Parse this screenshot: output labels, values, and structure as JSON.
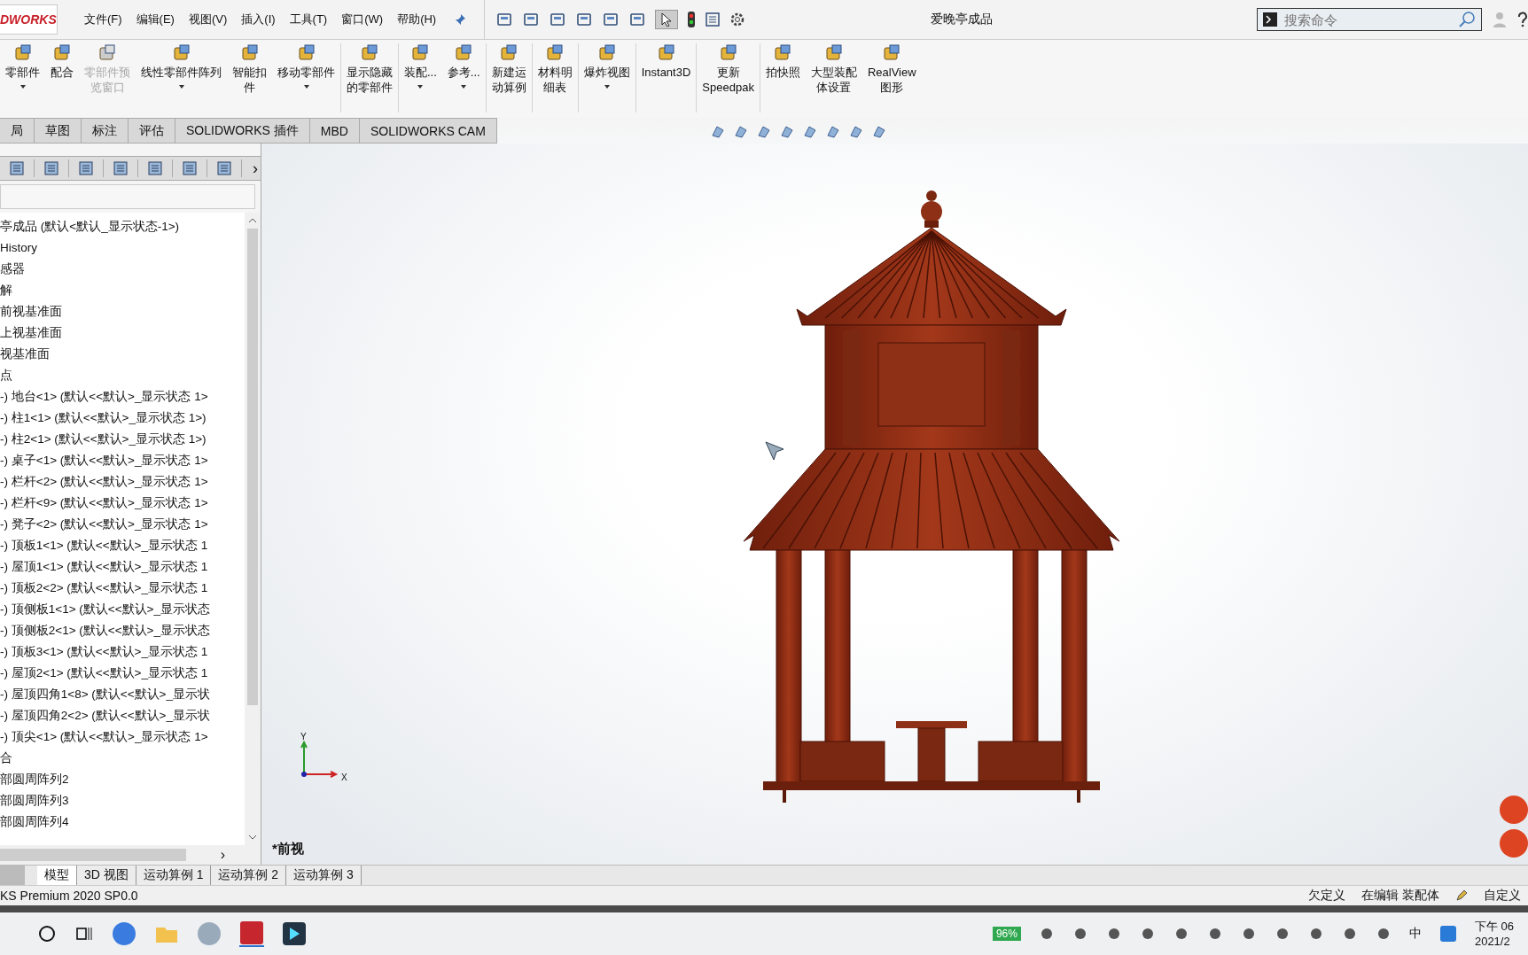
{
  "window": {
    "title": "爱晚亭成品",
    "logo": "DWORKS"
  },
  "menu": [
    "文件(F)",
    "编辑(E)",
    "视图(V)",
    "插入(I)",
    "工具(T)",
    "窗口(W)",
    "帮助(H)"
  ],
  "search": {
    "placeholder": "搜索命令"
  },
  "ribbon": [
    {
      "lines": [
        "零部件"
      ],
      "disabled": false,
      "dropdown": true,
      "divider": false
    },
    {
      "lines": [
        "配合"
      ],
      "disabled": false,
      "dropdown": false,
      "divider": false
    },
    {
      "lines": [
        "零部件预",
        "览窗口"
      ],
      "disabled": true,
      "dropdown": false,
      "divider": false
    },
    {
      "lines": [
        "线性零部件阵列"
      ],
      "disabled": false,
      "dropdown": true,
      "divider": false
    },
    {
      "lines": [
        "智能扣",
        "件"
      ],
      "disabled": false,
      "dropdown": false,
      "divider": false
    },
    {
      "lines": [
        "移动零部件"
      ],
      "disabled": false,
      "dropdown": true,
      "divider": true
    },
    {
      "lines": [
        "显示隐藏",
        "的零部件"
      ],
      "disabled": false,
      "dropdown": false,
      "divider": true
    },
    {
      "lines": [
        "装配..."
      ],
      "disabled": false,
      "dropdown": true,
      "divider": false
    },
    {
      "lines": [
        "参考..."
      ],
      "disabled": false,
      "dropdown": true,
      "divider": true
    },
    {
      "lines": [
        "新建运",
        "动算例"
      ],
      "disabled": false,
      "dropdown": false,
      "divider": true
    },
    {
      "lines": [
        "材料明",
        "细表"
      ],
      "disabled": false,
      "dropdown": false,
      "divider": true
    },
    {
      "lines": [
        "爆炸视图"
      ],
      "disabled": false,
      "dropdown": true,
      "divider": true
    },
    {
      "lines": [
        "Instant3D"
      ],
      "disabled": false,
      "dropdown": false,
      "divider": true
    },
    {
      "lines": [
        "更新",
        "Speedpak"
      ],
      "disabled": false,
      "dropdown": false,
      "divider": true
    },
    {
      "lines": [
        "拍快照"
      ],
      "disabled": false,
      "dropdown": false,
      "divider": false
    },
    {
      "lines": [
        "大型装配",
        "体设置"
      ],
      "disabled": false,
      "dropdown": false,
      "divider": false
    },
    {
      "lines": [
        "RealView",
        "图形"
      ],
      "disabled": false,
      "dropdown": false,
      "divider": false
    }
  ],
  "command_tabs": [
    {
      "label": "局",
      "selected": false
    },
    {
      "label": "草图",
      "selected": false
    },
    {
      "label": "标注",
      "selected": false
    },
    {
      "label": "评估",
      "selected": false
    },
    {
      "label": "SOLIDWORKS 插件",
      "selected": false
    },
    {
      "label": "MBD",
      "selected": false
    },
    {
      "label": "SOLIDWORKS CAM",
      "selected": false
    }
  ],
  "panel_more": "›",
  "tree": [
    "亭成品  (默认<默认_显示状态-1>)",
    "History",
    "感器",
    "解",
    "前视基准面",
    "上视基准面",
    "视基准面",
    "点",
    "-) 地台<1> (默认<<默认>_显示状态 1>",
    "-) 柱1<1> (默认<<默认>_显示状态 1>)",
    "-) 柱2<1> (默认<<默认>_显示状态 1>)",
    "-) 桌子<1> (默认<<默认>_显示状态 1>",
    "-) 栏杆<2> (默认<<默认>_显示状态 1>",
    "-) 栏杆<9> (默认<<默认>_显示状态 1>",
    "-) 凳子<2> (默认<<默认>_显示状态 1>",
    "-) 顶板1<1> (默认<<默认>_显示状态 1",
    "-) 屋顶1<1> (默认<<默认>_显示状态 1",
    "-) 顶板2<2> (默认<<默认>_显示状态 1",
    "-) 顶侧板1<1> (默认<<默认>_显示状态",
    "-) 顶侧板2<1> (默认<<默认>_显示状态",
    "-) 顶板3<1> (默认<<默认>_显示状态 1",
    "-) 屋顶2<1> (默认<<默认>_显示状态 1",
    "-) 屋顶四角1<8> (默认<<默认>_显示状",
    "-) 屋顶四角2<2> (默认<<默认>_显示状",
    "-) 顶尖<1> (默认<<默认>_显示状态 1>",
    "合",
    "部圆周阵列2",
    "部圆周阵列3",
    "部圆周阵列4"
  ],
  "tree_scroll_right": "›",
  "view_label": "*前视",
  "triad": {
    "y": "Y",
    "x": "X"
  },
  "bottom_tabs": [
    {
      "label": "模型",
      "selected": true
    },
    {
      "label": "3D 视图",
      "selected": false
    },
    {
      "label": "运动算例 1",
      "selected": false
    },
    {
      "label": "运动算例 2",
      "selected": false
    },
    {
      "label": "运动算例 3",
      "selected": false
    }
  ],
  "status_bar": {
    "product": "KS Premium 2020 SP0.0",
    "definition": "欠定义",
    "mode": "在编辑 装配体",
    "units": "自定义"
  },
  "taskbar": {
    "battery": "96%",
    "ime": "中",
    "time": "下午 06",
    "date": "2021/2"
  }
}
